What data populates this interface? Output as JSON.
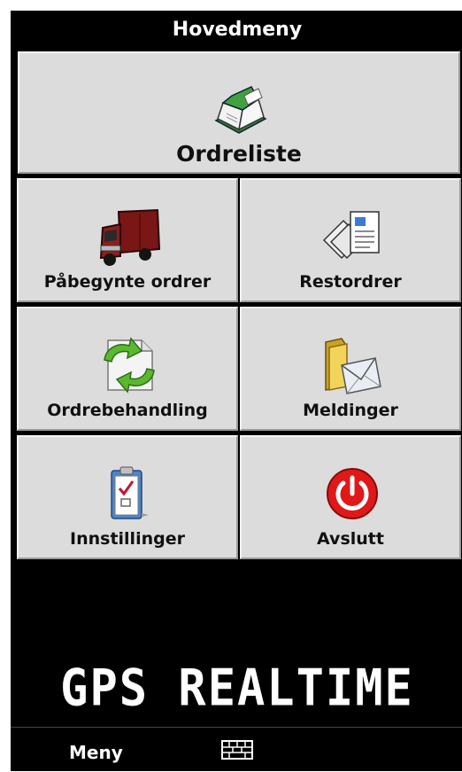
{
  "header": {
    "title": "Hovedmeny"
  },
  "menu": {
    "main_tile": {
      "label": "Ordreliste",
      "icon": "open-book-icon"
    },
    "tiles": [
      {
        "label": "Påbegynte ordrer",
        "icon": "delivery-truck-icon"
      },
      {
        "label": "Restordrer",
        "icon": "documents-stack-icon"
      },
      {
        "label": "Ordrebehandling",
        "icon": "sync-arrows-icon"
      },
      {
        "label": "Meldinger",
        "icon": "folder-envelope-icon"
      },
      {
        "label": "Innstillinger",
        "icon": "clipboard-check-icon"
      },
      {
        "label": "Avslutt",
        "icon": "power-icon"
      }
    ]
  },
  "brand": {
    "text": "GPS REALTIME"
  },
  "softkeys": {
    "left_label": "Meny",
    "center_icon": "keyboard-icon"
  },
  "colors": {
    "background": "#000000",
    "tile": "#dcdcdc",
    "power_red": "#e01818",
    "truck_red": "#7a1616"
  }
}
